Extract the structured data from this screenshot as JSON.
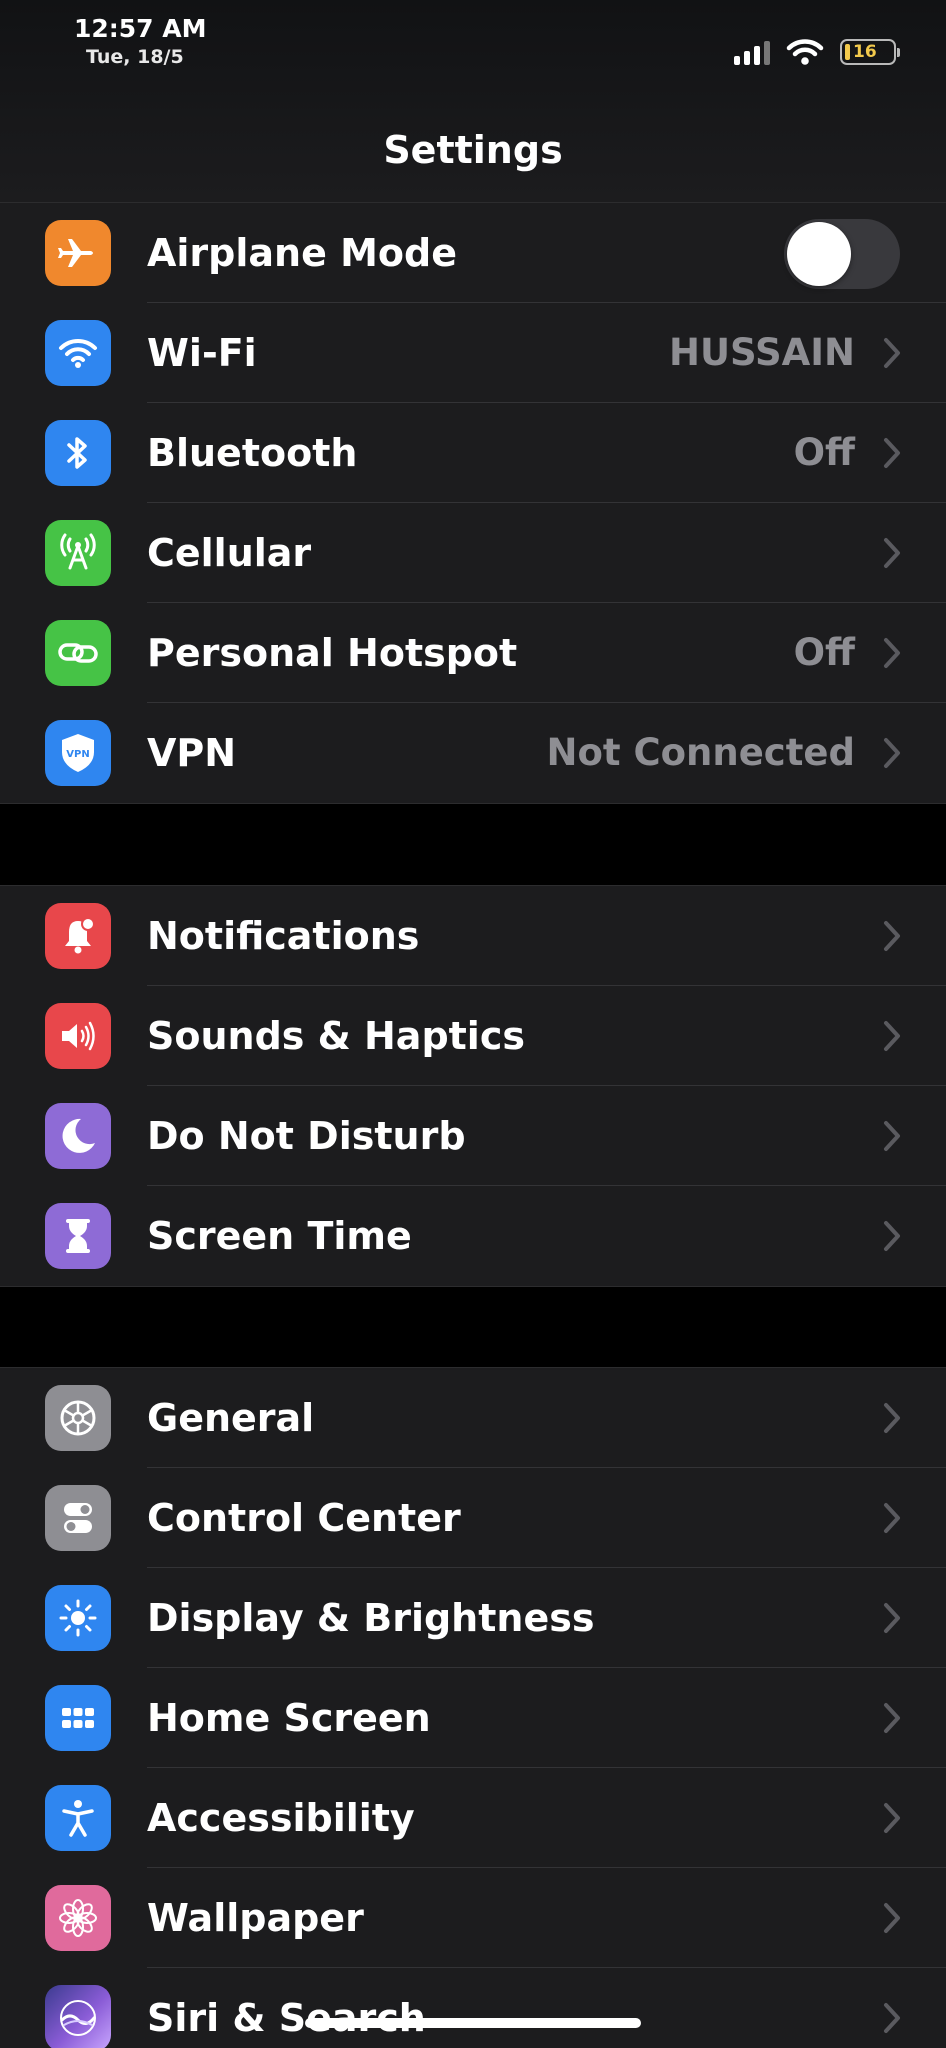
{
  "status": {
    "time": "12:57 AM",
    "date": "Tue, 18/5",
    "battery_level": "16"
  },
  "header": {
    "title": "Settings"
  },
  "groups": [
    {
      "rows": [
        {
          "label": "Airplane Mode",
          "icon": "airplane-icon",
          "color": "#f0882d",
          "toggle": false
        },
        {
          "label": "Wi-Fi",
          "icon": "wifi-icon",
          "color": "#2f86f0",
          "value": "HUSSAIN"
        },
        {
          "label": "Bluetooth",
          "icon": "bluetooth-icon",
          "color": "#2f86f0",
          "value": "Off"
        },
        {
          "label": "Cellular",
          "icon": "antenna-icon",
          "color": "#46c346"
        },
        {
          "label": "Personal Hotspot",
          "icon": "chain-link-icon",
          "color": "#46c346",
          "value": "Off"
        },
        {
          "label": "VPN",
          "icon": "vpn-shield-icon",
          "color": "#2f86f0",
          "value": "Not Connected",
          "icon_text": "VPN"
        }
      ]
    },
    {
      "rows": [
        {
          "label": "Notifications",
          "icon": "bell-icon",
          "color": "#e8474b"
        },
        {
          "label": "Sounds & Haptics",
          "icon": "speaker-icon",
          "color": "#e8474b"
        },
        {
          "label": "Do Not Disturb",
          "icon": "moon-icon",
          "color": "#8e6bd6"
        },
        {
          "label": "Screen Time",
          "icon": "hourglass-icon",
          "color": "#8e6bd6"
        }
      ]
    },
    {
      "rows": [
        {
          "label": "General",
          "icon": "gear-icon",
          "color": "#8e8e93"
        },
        {
          "label": "Control Center",
          "icon": "switches-icon",
          "color": "#8e8e93"
        },
        {
          "label": "Display & Brightness",
          "icon": "sun-icon",
          "color": "#2f86f0"
        },
        {
          "label": "Home Screen",
          "icon": "app-grid-icon",
          "color": "#2f86f0"
        },
        {
          "label": "Accessibility",
          "icon": "accessibility-icon",
          "color": "#2f86f0"
        },
        {
          "label": "Wallpaper",
          "icon": "flower-icon",
          "color": "#e06a9c"
        },
        {
          "label": "Siri & Search",
          "icon": "siri-icon",
          "color": "#6e5fd0"
        }
      ]
    }
  ]
}
